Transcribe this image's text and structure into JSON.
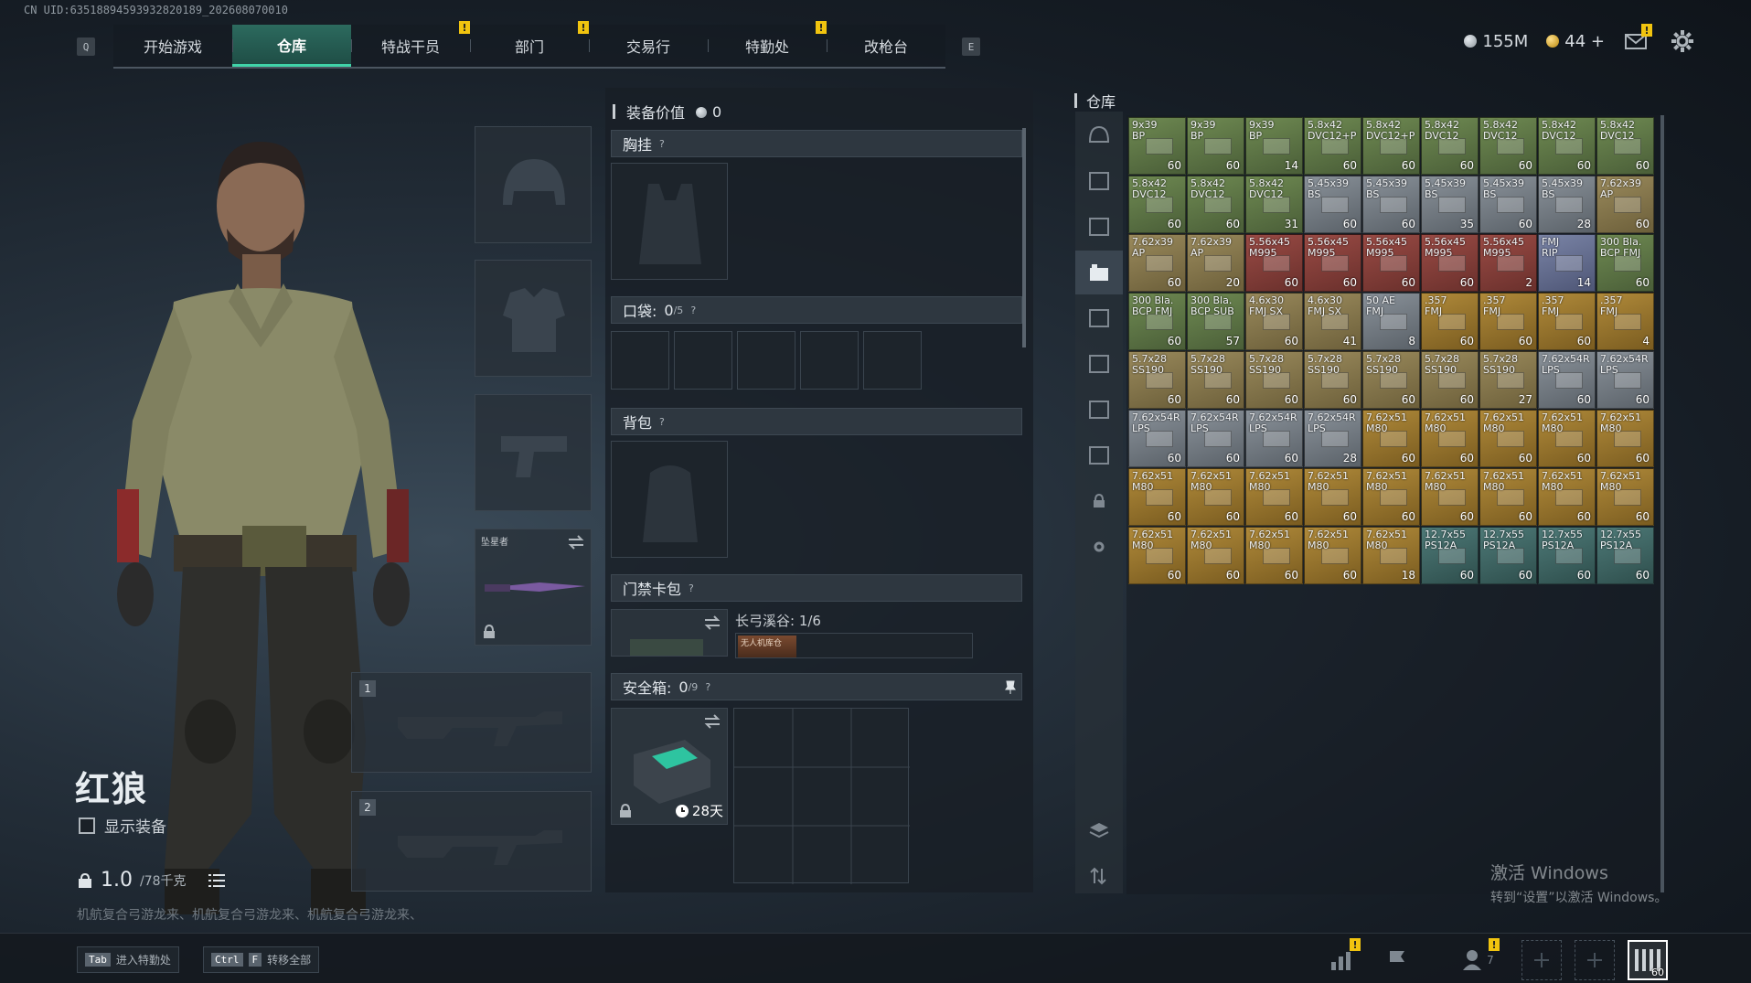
{
  "uid": "CN UID:6351889459393282018​9_202608070010",
  "nav": {
    "left_key": "Q",
    "right_key": "E",
    "tabs": [
      {
        "label": "开始游戏",
        "active": false,
        "alert": false
      },
      {
        "label": "仓库",
        "active": true,
        "alert": false
      },
      {
        "label": "特战干员",
        "active": false,
        "alert": true
      },
      {
        "label": "部门",
        "active": false,
        "alert": true
      },
      {
        "label": "交易行",
        "active": false,
        "alert": false
      },
      {
        "label": "特勤处",
        "active": false,
        "alert": true
      },
      {
        "label": "改枪台",
        "active": false,
        "alert": false
      }
    ],
    "alert_mark": "!"
  },
  "currency": {
    "silver": "155M",
    "gold": "44",
    "add": "+"
  },
  "character": {
    "name": "红狼",
    "show_equipment": "显示装备",
    "weight_value": "1.0",
    "weight_max": "/78千克",
    "ticker": "机航复合弓游龙来、机航复合弓游龙来、机航复合弓游龙来、"
  },
  "slots": {
    "melee_name": "坠星者",
    "weapon1_num": "1",
    "weapon2_num": "2"
  },
  "loadout": {
    "value_label": "装备价值",
    "value": "0",
    "chest_rig": "胸挂",
    "pockets_label": "口袋:",
    "pockets_used": "0",
    "pockets_max": "/5",
    "backpack": "背包",
    "keycard_label": "门禁卡包",
    "keycard_map": "长弓溪谷: 1/6",
    "keycard_card": "无人机库仓",
    "safebox_label": "安全箱:",
    "safebox_used": "0",
    "safebox_max": "/9",
    "safebox_days": "28天",
    "help": "?"
  },
  "storage": {
    "title": "仓库",
    "items": [
      {
        "name": "9x39\nBP",
        "count": "60",
        "color": "green"
      },
      {
        "name": "9x39\nBP",
        "count": "60",
        "color": "green"
      },
      {
        "name": "9x39\nBP",
        "count": "14",
        "color": "green"
      },
      {
        "name": "5.8x42\nDVC12+P",
        "count": "60",
        "color": "green"
      },
      {
        "name": "5.8x42\nDVC12+P",
        "count": "60",
        "color": "green"
      },
      {
        "name": "5.8x42\nDVC12",
        "count": "60",
        "color": "green"
      },
      {
        "name": "5.8x42\nDVC12",
        "count": "60",
        "color": "green"
      },
      {
        "name": "5.8x42\nDVC12",
        "count": "60",
        "color": "green"
      },
      {
        "name": "5.8x42\nDVC12",
        "count": "60",
        "color": "green"
      },
      {
        "name": "5.8x42\nDVC12",
        "count": "60",
        "color": "green"
      },
      {
        "name": "5.8x42\nDVC12",
        "count": "60",
        "color": "green"
      },
      {
        "name": "5.8x42\nDVC12",
        "count": "31",
        "color": "green"
      },
      {
        "name": "5.45x39\nBS",
        "count": "60",
        "color": "gray"
      },
      {
        "name": "5.45x39\nBS",
        "count": "60",
        "color": "gray"
      },
      {
        "name": "5.45x39\nBS",
        "count": "35",
        "color": "gray"
      },
      {
        "name": "5.45x39\nBS",
        "count": "60",
        "color": "gray"
      },
      {
        "name": "5.45x39\nBS",
        "count": "28",
        "color": "gray"
      },
      {
        "name": "7.62x39\nAP",
        "count": "60",
        "color": "tan"
      },
      {
        "name": "7.62x39\nAP",
        "count": "60",
        "color": "tan"
      },
      {
        "name": "7.62x39\nAP",
        "count": "20",
        "color": "tan"
      },
      {
        "name": "5.56x45\nM995",
        "count": "60",
        "color": "red"
      },
      {
        "name": "5.56x45\nM995",
        "count": "60",
        "color": "red"
      },
      {
        "name": "5.56x45\nM995",
        "count": "60",
        "color": "red"
      },
      {
        "name": "5.56x45\nM995",
        "count": "60",
        "color": "red"
      },
      {
        "name": "5.56x45\nM995",
        "count": "2",
        "color": "red"
      },
      {
        "name": "FMJ\nRIP",
        "count": "14",
        "color": "purple"
      },
      {
        "name": "300 Bla.\nBCP FMJ",
        "count": "60",
        "color": "green"
      },
      {
        "name": "300 Bla.\nBCP FMJ",
        "count": "60",
        "color": "green"
      },
      {
        "name": "300 Bla.\nBCP SUB",
        "count": "57",
        "color": "green"
      },
      {
        "name": "4.6x30\nFMJ SX",
        "count": "60",
        "color": "tan"
      },
      {
        "name": "4.6x30\nFMJ SX",
        "count": "41",
        "color": "tan"
      },
      {
        "name": "50 AE\nFMJ",
        "count": "8",
        "color": "gray"
      },
      {
        "name": ".357\nFMJ",
        "count": "60",
        "color": "yellow"
      },
      {
        "name": ".357\nFMJ",
        "count": "60",
        "color": "yellow"
      },
      {
        "name": ".357\nFMJ",
        "count": "60",
        "color": "yellow"
      },
      {
        "name": ".357\nFMJ",
        "count": "4",
        "color": "yellow"
      },
      {
        "name": "5.7x28\nSS190",
        "count": "60",
        "color": "tan"
      },
      {
        "name": "5.7x28\nSS190",
        "count": "60",
        "color": "tan"
      },
      {
        "name": "5.7x28\nSS190",
        "count": "60",
        "color": "tan"
      },
      {
        "name": "5.7x28\nSS190",
        "count": "60",
        "color": "tan"
      },
      {
        "name": "5.7x28\nSS190",
        "count": "60",
        "color": "tan"
      },
      {
        "name": "5.7x28\nSS190",
        "count": "60",
        "color": "tan"
      },
      {
        "name": "5.7x28\nSS190",
        "count": "27",
        "color": "tan"
      },
      {
        "name": "7.62x54R\nLPS",
        "count": "60",
        "color": "gray"
      },
      {
        "name": "7.62x54R\nLPS",
        "count": "60",
        "color": "gray"
      },
      {
        "name": "7.62x54R\nLPS",
        "count": "60",
        "color": "gray"
      },
      {
        "name": "7.62x54R\nLPS",
        "count": "60",
        "color": "gray"
      },
      {
        "name": "7.62x54R\nLPS",
        "count": "60",
        "color": "gray"
      },
      {
        "name": "7.62x54R\nLPS",
        "count": "28",
        "color": "gray"
      },
      {
        "name": "7.62x51\nM80",
        "count": "60",
        "color": "yellow"
      },
      {
        "name": "7.62x51\nM80",
        "count": "60",
        "color": "yellow"
      },
      {
        "name": "7.62x51\nM80",
        "count": "60",
        "color": "yellow"
      },
      {
        "name": "7.62x51\nM80",
        "count": "60",
        "color": "yellow"
      },
      {
        "name": "7.62x51\nM80",
        "count": "60",
        "color": "yellow"
      },
      {
        "name": "7.62x51\nM80",
        "count": "60",
        "color": "yellow"
      },
      {
        "name": "7.62x51\nM80",
        "count": "60",
        "color": "yellow"
      },
      {
        "name": "7.62x51\nM80",
        "count": "60",
        "color": "yellow"
      },
      {
        "name": "7.62x51\nM80",
        "count": "60",
        "color": "yellow"
      },
      {
        "name": "7.62x51\nM80",
        "count": "60",
        "color": "yellow"
      },
      {
        "name": "7.62x51\nM80",
        "count": "60",
        "color": "yellow"
      },
      {
        "name": "7.62x51\nM80",
        "count": "60",
        "color": "yellow"
      },
      {
        "name": "7.62x51\nM80",
        "count": "60",
        "color": "yellow"
      },
      {
        "name": "7.62x51\nM80",
        "count": "60",
        "color": "yellow"
      },
      {
        "name": "7.62x51\nM80",
        "count": "60",
        "color": "yellow"
      },
      {
        "name": "7.62x51\nM80",
        "count": "60",
        "color": "yellow"
      },
      {
        "name": "7.62x51\nM80",
        "count": "60",
        "color": "yellow"
      },
      {
        "name": "7.62x51\nM80",
        "count": "60",
        "color": "yellow"
      },
      {
        "name": "7.62x51\nM80",
        "count": "18",
        "color": "yellow"
      },
      {
        "name": "12.7x55\nPS12A",
        "count": "60",
        "color": "teal"
      },
      {
        "name": "12.7x55\nPS12A",
        "count": "60",
        "color": "teal"
      },
      {
        "name": "12.7x55\nPS12A",
        "count": "60",
        "color": "teal"
      },
      {
        "name": "12.7x55\nPS12A",
        "count": "60",
        "color": "teal"
      }
    ]
  },
  "watermark": {
    "line1": "激活 Windows",
    "line2": "转到“设置”以激活 Windows。"
  },
  "bottom": {
    "hint1_key": "Tab",
    "hint1_text": "进入特勤处",
    "hint2_key1": "Ctrl",
    "hint2_key2": "F",
    "hint2_text": "转移全部",
    "squad_count": "7",
    "level": "60"
  },
  "colors": {
    "accent": "#40d3a8",
    "active_tab": "#2c6a5e",
    "alert": "#f1c40f"
  }
}
